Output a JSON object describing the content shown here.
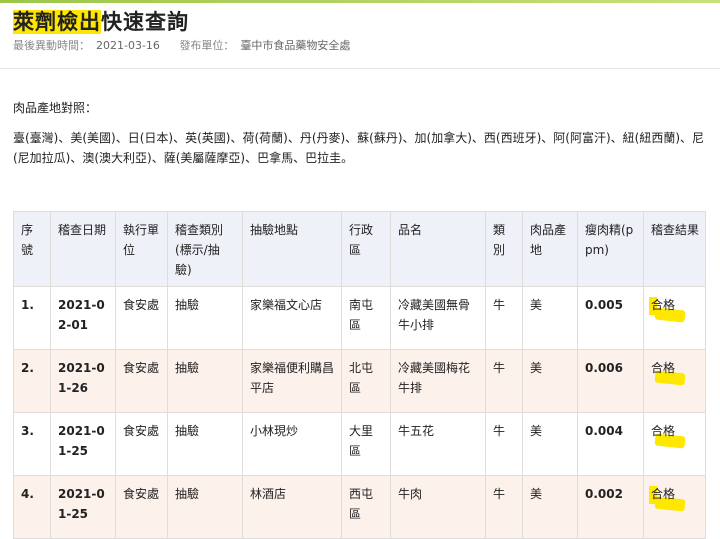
{
  "header": {
    "title_part1": "萊劑檢出",
    "title_part2": "快速查詢",
    "updated_label": "最後異動時間：",
    "updated_value": "2021-03-16",
    "publisher_label": "發布單位：",
    "publisher_value": "臺中市食品藥物安全處"
  },
  "origin": {
    "title": "肉品產地對照：",
    "text": "臺(臺灣)、美(美國)、日(日本)、英(英國)、荷(荷蘭)、丹(丹麥)、蘇(蘇丹)、加(加拿大)、西(西班牙)、阿(阿富汗)、紐(紐西蘭)、尼(尼加拉瓜)、澳(澳大利亞)、薩(美屬薩摩亞)、巴拿馬、巴拉圭。"
  },
  "table": {
    "headers": [
      "序號",
      "稽查日期",
      "執行單位",
      "稽查類別(標示/抽驗)",
      "抽驗地點",
      "行政區",
      "品名",
      "類別",
      "肉品產地",
      "瘦肉精(ppm)",
      "稽查結果"
    ],
    "rows": [
      {
        "no": "1.",
        "date": "2021-02-01",
        "unit": "食安處",
        "type": "抽驗",
        "location": "家樂福文心店",
        "district": "南屯區",
        "product": "冷藏美國無骨牛小排",
        "category": "牛",
        "origin": "美",
        "ppm": "0.005",
        "result": "合格"
      },
      {
        "no": "2.",
        "date": "2021-01-26",
        "unit": "食安處",
        "type": "抽驗",
        "location": "家樂福便利購昌平店",
        "district": "北屯區",
        "product": "冷藏美國梅花牛排",
        "category": "牛",
        "origin": "美",
        "ppm": "0.006",
        "result": "合格"
      },
      {
        "no": "3.",
        "date": "2021-01-25",
        "unit": "食安處",
        "type": "抽驗",
        "location": "小林現炒",
        "district": "大里區",
        "product": "牛五花",
        "category": "牛",
        "origin": "美",
        "ppm": "0.004",
        "result": "合格"
      },
      {
        "no": "4.",
        "date": "2021-01-25",
        "unit": "食安處",
        "type": "抽驗",
        "location": "林酒店",
        "district": "西屯區",
        "product": "牛肉",
        "category": "牛",
        "origin": "美",
        "ppm": "0.002",
        "result": "合格"
      }
    ]
  },
  "colors": {
    "highlight": "#ffe600",
    "header_bg": "#eef1f8",
    "stripe_bg": "#fdf1ec",
    "accent_bar": "#9cc64a"
  }
}
